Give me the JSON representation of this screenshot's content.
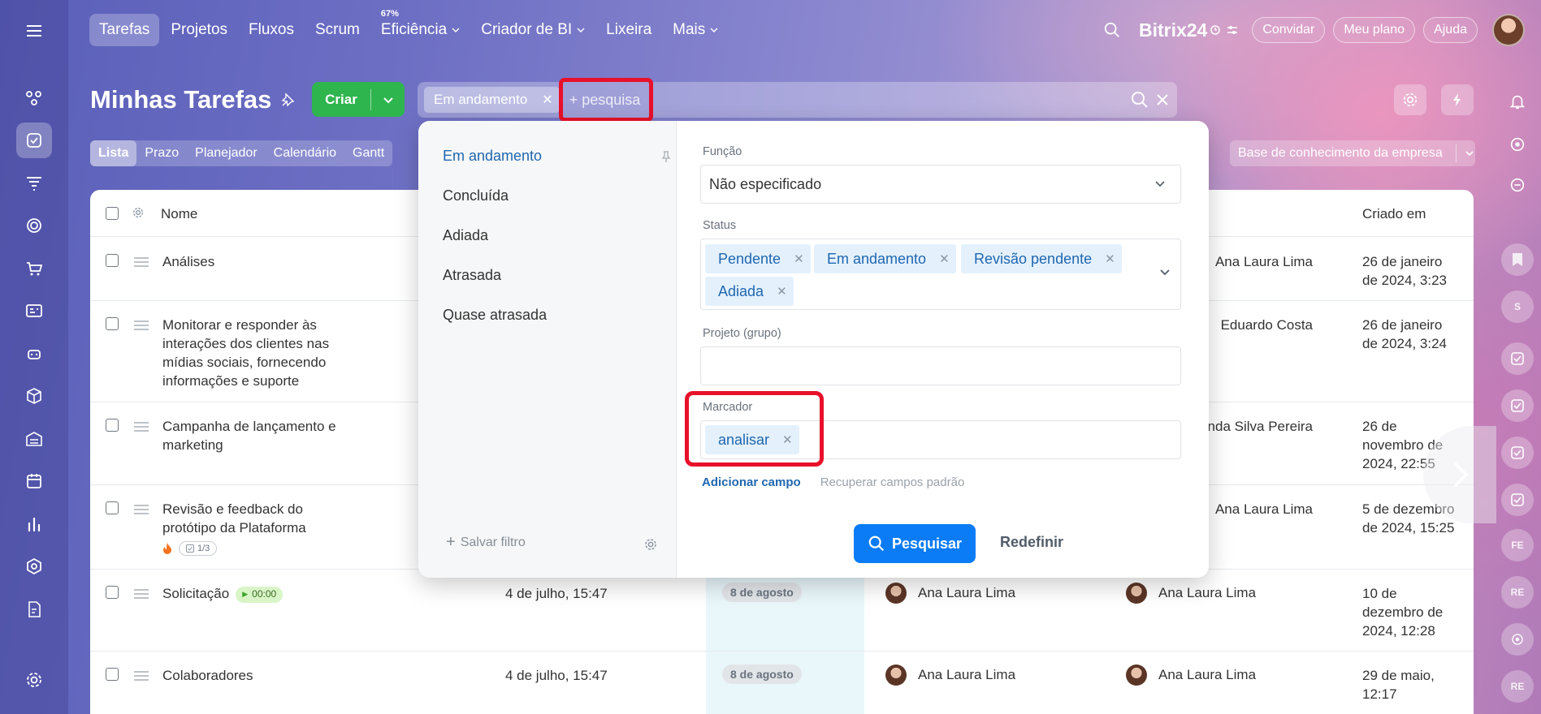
{
  "topnav": {
    "items": [
      {
        "label": "Tarefas"
      },
      {
        "label": "Projetos"
      },
      {
        "label": "Fluxos"
      },
      {
        "label": "Scrum"
      },
      {
        "label": "Eficiência",
        "badge": "67%"
      },
      {
        "label": "Criador de BI"
      },
      {
        "label": "Lixeira"
      },
      {
        "label": "Mais"
      }
    ],
    "brand": "Bitrix24",
    "invite": "Convidar",
    "plan": "Meu plano",
    "help": "Ajuda"
  },
  "page": {
    "title": "Minhas Tarefas",
    "create_label": "Criar",
    "filter_chip": "Em andamento",
    "search_placeholder": "+ pesquisa",
    "views": [
      "Lista",
      "Prazo",
      "Planejador",
      "Calendário",
      "Gantt"
    ],
    "knowledge_base": "Base de conhecimento da empresa"
  },
  "table": {
    "headers": {
      "name": "Nome",
      "created": "Criado em"
    },
    "rows": [
      {
        "name": "Análises",
        "responsible": "Ana Laura Lima",
        "created": [
          "26 de janeiro",
          "de 2024, 3:23"
        ]
      },
      {
        "name": "Monitorar e responder às interações dos clientes nas mídias sociais, fornecendo informações e suporte",
        "responsible": "Eduardo Costa",
        "created": [
          "26 de janeiro",
          "de 2024, 3:24"
        ]
      },
      {
        "name": "Campanha de lançamento e marketing",
        "responsible": "Amanda Silva Pereira",
        "created": [
          "26 de",
          "novembro de",
          "2024, 22:55"
        ]
      },
      {
        "name": "Revisão e feedback do protótipo da Plataforma",
        "responsible": "Ana Laura Lima",
        "created": [
          "5 de dezembro",
          "de 2024, 15:25"
        ],
        "checklist": "1/3"
      },
      {
        "name": "Solicitação",
        "activity": "4 de julho, 15:47",
        "deadline": "8 de agosto",
        "creator": "Ana Laura Lima",
        "responsible": "Ana Laura Lima",
        "created": [
          "10 de",
          "dezembro de",
          "2024, 12:28"
        ],
        "timer": "00:00"
      },
      {
        "name": "Colaboradores",
        "activity": "4 de julho, 15:47",
        "deadline": "8 de agosto",
        "creator": "Ana Laura Lima",
        "responsible": "Ana Laura Lima",
        "created": [
          "29 de maio,",
          "12:17"
        ]
      }
    ]
  },
  "filter_panel": {
    "presets": [
      "Em andamento",
      "Concluída",
      "Adiada",
      "Atrasada",
      "Quase atrasada"
    ],
    "save_filter": "Salvar filtro",
    "fields": {
      "role": {
        "label": "Função",
        "value": "Não especificado"
      },
      "status": {
        "label": "Status",
        "tags": [
          "Pendente",
          "Em andamento",
          "Revisão pendente",
          "Adiada"
        ]
      },
      "project": {
        "label": "Projeto (grupo)",
        "value": ""
      },
      "tag": {
        "label": "Marcador",
        "tags": [
          "analisar"
        ]
      }
    },
    "add_field": "Adicionar campo",
    "restore_fields": "Recuperar campos padrão",
    "search_btn": "Pesquisar",
    "reset_btn": "Redefinir"
  },
  "right_rail": {
    "avatars": [
      "S",
      "FE",
      "RE",
      "RE"
    ]
  },
  "colors": {
    "accent": "#0b7cf5",
    "create": "#2fb54e",
    "highlight": "#e8102a"
  }
}
